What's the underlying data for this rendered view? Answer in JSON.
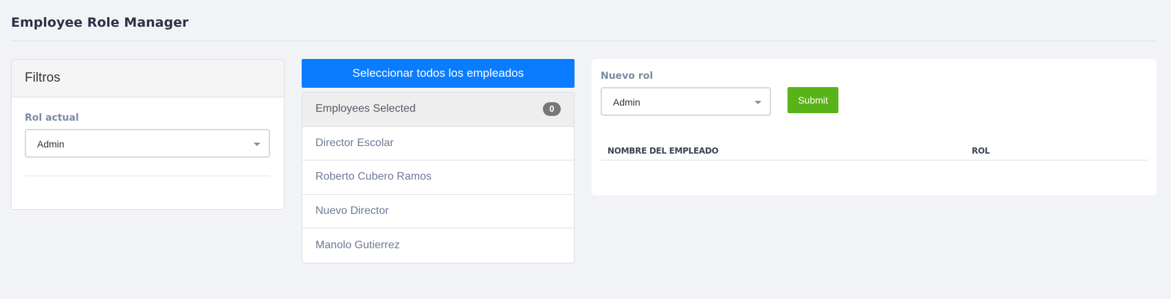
{
  "page": {
    "title": "Employee Role Manager"
  },
  "filters": {
    "title": "Filtros",
    "current_role_label": "Rol actual",
    "current_role_value": "Admin"
  },
  "employees": {
    "select_all_label": "Seleccionar todos los empleados",
    "selected_label": "Employees Selected",
    "selected_count": "0",
    "items": [
      {
        "name": "Director Escolar"
      },
      {
        "name": "Roberto Cubero Ramos"
      },
      {
        "name": "Nuevo Director"
      },
      {
        "name": "Manolo Gutierrez"
      }
    ]
  },
  "assign": {
    "new_role_label": "Nuevo rol",
    "new_role_value": "Admin",
    "submit_label": "Submit",
    "table_headers": {
      "name": "NOMBRE DEL EMPLEADO",
      "role": "ROL"
    }
  },
  "colors": {
    "background": "#f2f3f7",
    "primary": "#0a7cff",
    "success": "#57b318",
    "badge": "#777777"
  }
}
